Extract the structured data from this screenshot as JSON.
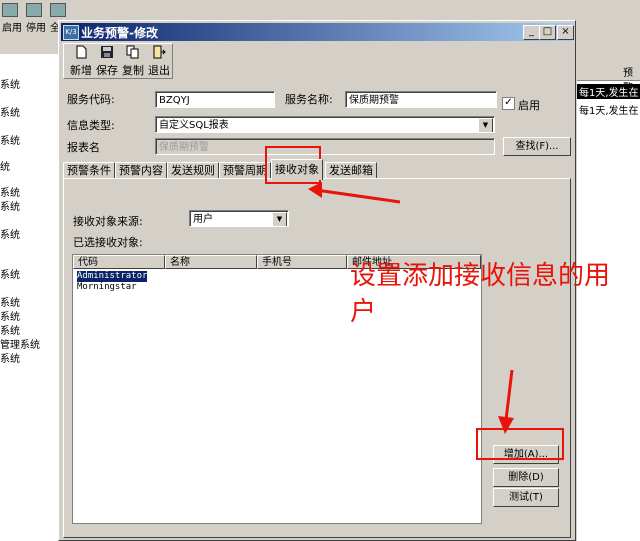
{
  "background": {
    "toolbar": [
      "启用",
      "停用",
      "全"
    ],
    "left_items": [
      "系统",
      "系统",
      "系统",
      "统",
      "系统",
      "系统",
      "系统",
      "系统",
      "系统",
      "系统",
      "系统",
      "管理系统",
      "系统"
    ],
    "right_header": "预警",
    "right_rows": [
      "每1天,发生在",
      "每1天,发生在"
    ]
  },
  "dialog": {
    "title": "业务预警-修改",
    "title_icon": "K/3",
    "toolbar": {
      "new": "新增",
      "save": "保存",
      "copy": "复制",
      "exit": "退出"
    },
    "form": {
      "service_code_label": "服务代码:",
      "service_code_value": "BZQYJ",
      "service_name_label": "服务名称:",
      "service_name_value": "保质期预警",
      "enabled_label": "启用",
      "enabled_mark": "✓",
      "info_type_label": "信息类型:",
      "info_type_value": "自定义SQL报表",
      "report_name_label": "报表名",
      "report_name_value": "保质期预警",
      "find_button": "查找(F)..."
    },
    "tabs": [
      "预警条件",
      "预警内容",
      "发送规则",
      "预警周期",
      "接收对象",
      "发送邮箱"
    ],
    "active_tab": 4,
    "receiver": {
      "source_label": "接收对象来源:",
      "source_value": "用户",
      "selected_label": "已选接收对象:",
      "columns": [
        "代码",
        "名称",
        "手机号",
        "邮件地址"
      ],
      "rows": [
        "Administrator",
        "Morningstar"
      ],
      "add_button": "增加(A)...",
      "delete_button": "删除(D)",
      "test_button": "测试(T)"
    }
  },
  "annotation": {
    "text": "设置添加接收信息的用户",
    "color": "#e8140a"
  }
}
